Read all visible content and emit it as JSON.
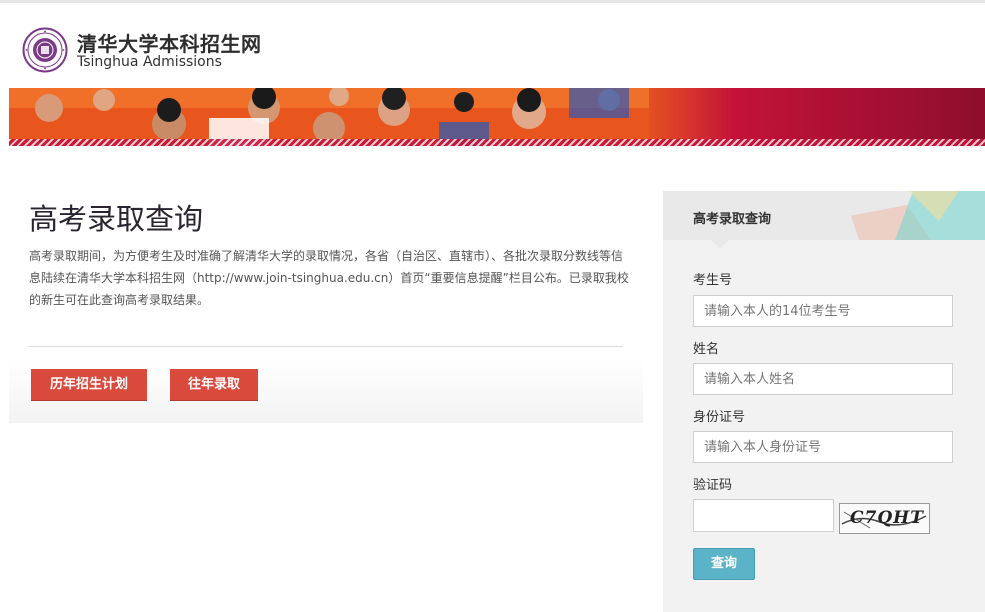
{
  "header": {
    "site_title": "清华大学本科招生网",
    "site_subtitle": "Tsinghua Admissions",
    "logo_icon": "tsinghua-seal-icon"
  },
  "banner": {
    "accent_color": "#c4123a"
  },
  "main": {
    "title": "高考录取查询",
    "description": "高考录取期间，为方便考生及时准确了解清华大学的录取情况，各省（自治区、直辖市）、各批次录取分数线等信息陆续在清华大学本科招生网（http://www.join-tsinghua.edu.cn）首页“重要信息提醒”栏目公布。已录取我校的新生可在此查询高考录取结果。",
    "buttons": {
      "plan_label": "历年招生计划",
      "past_label": "往年录取"
    },
    "button_color": "#d9493c"
  },
  "query_form": {
    "title": "高考录取查询",
    "exam_number": {
      "label": "考生号",
      "placeholder": "请输入本人的14位考生号",
      "value": ""
    },
    "name": {
      "label": "姓名",
      "placeholder": "请输入本人姓名",
      "value": ""
    },
    "id_card": {
      "label": "身份证号",
      "placeholder": "请输入本人身份证号",
      "value": ""
    },
    "captcha": {
      "label": "验证码",
      "value": "",
      "image_text": "C7QHT"
    },
    "submit_label": "查询",
    "submit_color": "#5ab3c7"
  }
}
